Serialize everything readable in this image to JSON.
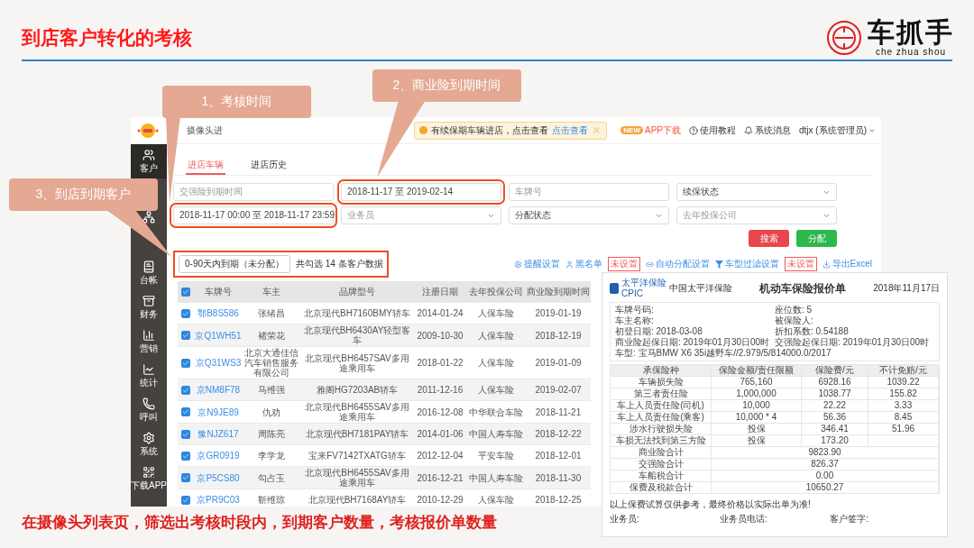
{
  "slide": {
    "title": "到店客户转化的考核",
    "logo": {
      "name": "车抓手",
      "pinyin": "che zhua shou"
    },
    "caption": "在摄像头列表页，筛选出考核时段内，到期客户数量，考核报价单数量"
  },
  "callouts": [
    {
      "text": "1、考核时间"
    },
    {
      "text": "2、商业险到期时间"
    },
    {
      "text": "3、到店到期客户"
    }
  ],
  "app": {
    "page_title": "摄像头进",
    "notice": {
      "text": "有续保期车辆进店，点击查看",
      "link": "点击查看"
    },
    "top_links": [
      {
        "kind": "app",
        "badge": "NEW",
        "label": "APP下载"
      },
      {
        "kind": "help",
        "label": "使用教程"
      },
      {
        "kind": "bell",
        "label": "系统消息"
      },
      {
        "kind": "user",
        "label": "dtjx (系统管理员)"
      }
    ],
    "sidebar": [
      {
        "label": "客户",
        "selected": true
      },
      {
        "selected": false
      },
      {
        "label": "台帐",
        "selected": false
      },
      {
        "label": "财务",
        "selected": false
      },
      {
        "label": "营销",
        "selected": false
      },
      {
        "label": "统计",
        "selected": false
      },
      {
        "label": "呼叫",
        "selected": false
      },
      {
        "label": "系统",
        "selected": false
      },
      {
        "label": "下载APP",
        "selected": false
      }
    ],
    "tabs": [
      {
        "label": "进店车辆",
        "selected": true
      },
      {
        "label": "进店历史",
        "selected": false
      }
    ],
    "filters": [
      {
        "kind": "input",
        "placeholder": "交强险到期时间",
        "highlighted": false
      },
      {
        "kind": "input",
        "value": "2018-11-17 至 2019-02-14",
        "highlighted": true
      },
      {
        "kind": "input",
        "placeholder": "车牌号",
        "highlighted": false
      },
      {
        "kind": "select",
        "value": "续保状态",
        "highlighted": false
      },
      {
        "kind": "input",
        "value": "2018-11-17 00:00 至 2018-11-17 23:59",
        "highlighted": true
      },
      {
        "kind": "select",
        "placeholder": "业务员",
        "highlighted": false
      },
      {
        "kind": "select",
        "value": "分配状态",
        "highlighted": false
      },
      {
        "kind": "select",
        "placeholder": "去年投保公司",
        "highlighted": false
      }
    ],
    "buttons": [
      {
        "kind": "search",
        "label": "搜索"
      },
      {
        "kind": "assign",
        "label": "分配"
      }
    ],
    "summary": {
      "highlighted": true,
      "range": "0-90天内到期（未分配）",
      "count_text": "共勾选 14 条客户数据"
    },
    "tools": [
      {
        "kind": "gear",
        "label": "提醒设置"
      },
      {
        "kind": "person",
        "label": "黑名单",
        "badge": "未设置"
      },
      {
        "kind": "link",
        "label": "自动分配设置"
      },
      {
        "kind": "filter",
        "label": "车型过滤设置",
        "badge": "未设置"
      },
      {
        "kind": "download",
        "label": "导出Excel"
      }
    ],
    "table": {
      "all_checked": true,
      "columns": [
        "车牌号",
        "车主",
        "品牌型号",
        "注册日期",
        "去年投保公司",
        "商业险到期时间"
      ],
      "rows": [
        {
          "checked": true,
          "cells": [
            "鄂B8S586",
            "张绪昌",
            "北京现代BH7160BMY轿车",
            "2014-01-24",
            "人保车险",
            "2019-01-19"
          ]
        },
        {
          "checked": true,
          "cells": [
            "京Q1WH51",
            "褚荣花",
            "北京现代BH6430AY轻型客车",
            "2009-10-30",
            "人保车险",
            "2018-12-19"
          ]
        },
        {
          "checked": true,
          "cells": [
            "京Q31WS3",
            "北京大通佳信汽车销售服务有限公司",
            "北京现代BH6457SAV多用途乘用车",
            "2018-01-22",
            "人保车险",
            "2019-01-09"
          ]
        },
        {
          "checked": true,
          "cells": [
            "京NM8F78",
            "马维强",
            "雅阁HG7203AB轿车",
            "2011-12-16",
            "人保车险",
            "2019-02-07"
          ]
        },
        {
          "checked": true,
          "cells": [
            "京N9JE89",
            "仇劝",
            "北京现代BH6455SAV多用途乘用车",
            "2016-12-08",
            "中华联合车险",
            "2018-11-21"
          ]
        },
        {
          "checked": true,
          "cells": [
            "豫NJZ617",
            "周陈亮",
            "北京现代BH7181PAY轿车",
            "2014-01-06",
            "中国人寿车险",
            "2018-12-22"
          ]
        },
        {
          "checked": true,
          "cells": [
            "京GR0919",
            "李学龙",
            "宝来FV7142TXATG轿车",
            "2012-12-04",
            "平安车险",
            "2018-12-01"
          ]
        },
        {
          "checked": true,
          "cells": [
            "京P5CS80",
            "勾占玉",
            "北京现代BH6455SAV多用途乘用车",
            "2016-12-21",
            "中国人寿车险",
            "2018-11-30"
          ]
        },
        {
          "checked": true,
          "cells": [
            "京PR9C03",
            "靳维琼",
            "北京现代BH7168AY轿车",
            "2010-12-29",
            "人保车险",
            "2018-12-25"
          ]
        }
      ]
    }
  },
  "quote": {
    "insurer": "太平洋保险",
    "insurer_en": "CPIC",
    "insurer_full": "中国太平洋保险",
    "title": "机动车保险报价单",
    "date": "2018年11月17日",
    "info": [
      "车牌号码:",
      "座位数: 5",
      "车主名称:",
      "被保险人:",
      "初登日期: 2018-03-08",
      "折扣系数: 0.54188",
      "商业险起保日期: 2019年01月30日00时",
      "交强险起保日期: 2019年01月30日00时",
      "车型: 宝马BMW X6 35i越野车//2.979/5/814000.0/2017"
    ],
    "columns": [
      "承保险种",
      "保险金额/责任限额",
      "保险费/元",
      "不计免赔/元"
    ],
    "rows": [
      [
        "车辆损失险",
        "765,160",
        "6928.16",
        "1039.22"
      ],
      [
        "第三者责任险",
        "1,000,000",
        "1038.77",
        "155.82"
      ],
      [
        "车上人员责任险(司机)",
        "10,000",
        "22.22",
        "3.33"
      ],
      [
        "车上人员责任险(乘客)",
        "10,000 * 4",
        "56.36",
        "8.45"
      ],
      [
        "涉水行驶损失险",
        "投保",
        "346.41",
        "51.96"
      ],
      [
        "车损无法找到第三方险",
        "投保",
        "173.20",
        ""
      ]
    ],
    "totals": [
      [
        "商业险合计",
        "9823.90"
      ],
      [
        "交强险合计",
        "826.37"
      ],
      [
        "车船税合计",
        "0.00"
      ],
      [
        "保费及税款合计",
        "10650.27"
      ]
    ],
    "note": "以上保费试算仅供参考，最终价格以实际出单为准!",
    "signatures": [
      "业务员:",
      "业务员电话:",
      "客户签字:"
    ]
  }
}
